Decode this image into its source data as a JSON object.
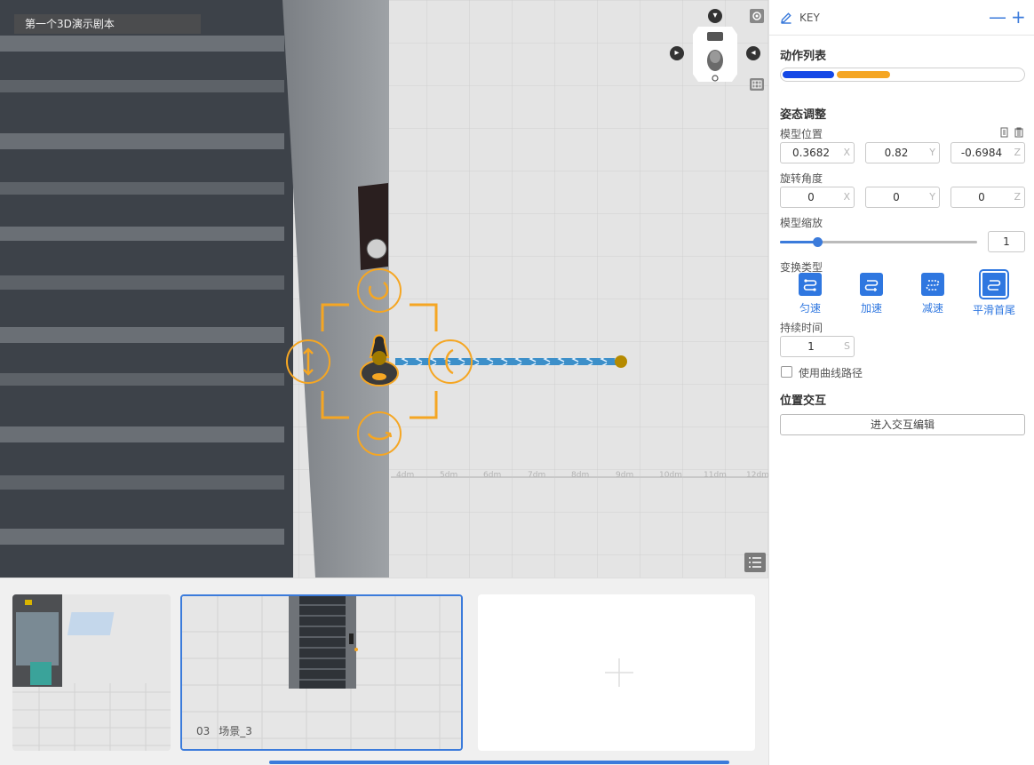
{
  "scene": {
    "title": "第一个3D演示剧本",
    "ruler_labels": [
      "4dm",
      "5dm",
      "6dm",
      "7dm",
      "8dm",
      "9dm",
      "10dm",
      "11dm",
      "12dm"
    ]
  },
  "strip": {
    "thumbnails": [
      {
        "index": "",
        "name": "",
        "selected": false
      },
      {
        "index": "03",
        "name": "场景_3",
        "selected": true
      }
    ],
    "add_symbol": "+"
  },
  "panel": {
    "header": {
      "key_label": "KEY",
      "minus": "—",
      "plus": "+"
    },
    "action_list": {
      "title": "动作列表",
      "segments": [
        {
          "color": "#1448e6"
        },
        {
          "color": "#f5a623"
        }
      ]
    },
    "pose": {
      "title": "姿态调整",
      "position_label": "模型位置",
      "position": [
        {
          "value": "0.3682",
          "axis": "X"
        },
        {
          "value": "0.82",
          "axis": "Y"
        },
        {
          "value": "-0.6984",
          "axis": "Z"
        }
      ],
      "rotation_label": "旋转角度",
      "rotation": [
        {
          "value": "0",
          "axis": "X"
        },
        {
          "value": "0",
          "axis": "Y"
        },
        {
          "value": "0",
          "axis": "Z"
        }
      ],
      "scale_label": "模型缩放",
      "scale_value": "1",
      "scale_fraction": 0.19,
      "transform_label": "变换类型",
      "transforms": [
        {
          "label": "匀速",
          "selected": false
        },
        {
          "label": "加速",
          "selected": false
        },
        {
          "label": "减速",
          "selected": false
        },
        {
          "label": "平滑首尾",
          "selected": true
        }
      ],
      "duration_label": "持续时间",
      "duration_value": "1",
      "duration_unit": "S",
      "curve_label": "使用曲线路径"
    },
    "interaction": {
      "title": "位置交互",
      "button": "进入交互编辑"
    }
  },
  "colors": {
    "accent": "#3b7bdb",
    "gizmo": "#f5a623"
  }
}
